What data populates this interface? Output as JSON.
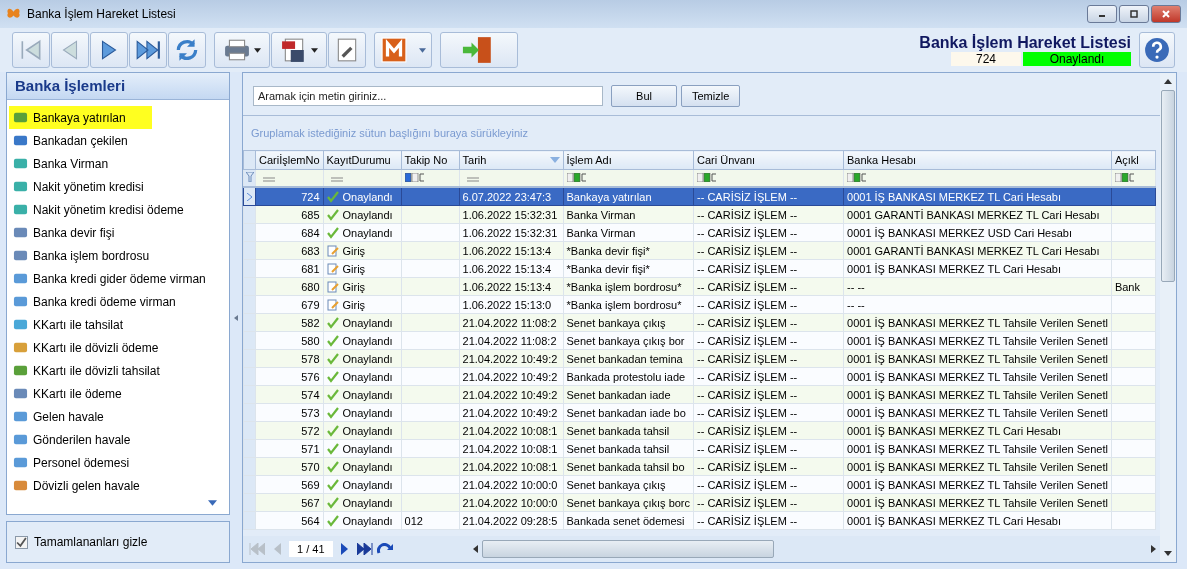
{
  "window": {
    "title": "Banka İşlem Hareket Listesi"
  },
  "header": {
    "title": "Banka İşlem Hareket Listesi",
    "record_no": "724",
    "status": "Onaylandı"
  },
  "sidebar": {
    "title": "Banka İşlemleri",
    "items": [
      {
        "label": "Bankaya yatırılan",
        "selected": true
      },
      {
        "label": "Bankadan çekilen",
        "selected": false
      },
      {
        "label": "Banka Virman",
        "selected": false
      },
      {
        "label": "Nakit yönetim kredisi",
        "selected": false
      },
      {
        "label": "Nakit yönetim kredisi ödeme",
        "selected": false
      },
      {
        "label": "Banka devir fişi",
        "selected": false
      },
      {
        "label": "Banka işlem bordrosu",
        "selected": false
      },
      {
        "label": "Banka kredi gider ödeme virman",
        "selected": false
      },
      {
        "label": "Banka kredi ödeme virman",
        "selected": false
      },
      {
        "label": "KKartı ile tahsilat",
        "selected": false
      },
      {
        "label": "KKartı ile dövizli ödeme",
        "selected": false
      },
      {
        "label": "KKartı ile dövizli tahsilat",
        "selected": false
      },
      {
        "label": "KKartı ile ödeme",
        "selected": false
      },
      {
        "label": "Gelen havale",
        "selected": false
      },
      {
        "label": "Gönderilen havale",
        "selected": false
      },
      {
        "label": "Personel ödemesi",
        "selected": false
      },
      {
        "label": "Dövizli gelen havale",
        "selected": false
      }
    ],
    "hide_completed": {
      "label": "Tamamlananları gizle",
      "checked": true
    }
  },
  "search": {
    "placeholder": "Aramak için metin giriniz...",
    "find_button": "Bul",
    "clear_button": "Temizle"
  },
  "group_hint": "Gruplamak istediğiniz sütun başlığını buraya sürükleyiniz",
  "table": {
    "columns": [
      {
        "label": "CariİşlemNo",
        "sorted": false,
        "kind": "equals"
      },
      {
        "label": "KayıtDurumu",
        "sorted": false,
        "kind": "equals"
      },
      {
        "label": "Takip No",
        "sorted": false,
        "kind": "text"
      },
      {
        "label": "Tarih",
        "sorted": true,
        "kind": "equals"
      },
      {
        "label": "İşlem Adı",
        "sorted": false,
        "kind": "text"
      },
      {
        "label": "Cari Ünvanı",
        "sorted": false,
        "kind": "text"
      },
      {
        "label": "Banka Hesabı",
        "sorted": false,
        "kind": "text"
      },
      {
        "label": "Açıkl",
        "sorted": false,
        "kind": "text"
      }
    ],
    "rows": [
      {
        "selected": true,
        "no": "724",
        "status": {
          "kind": "approved",
          "label": "Onaylandı"
        },
        "takip": "",
        "date": "6.07.2022 23:47:3",
        "name": "Bankaya yatırılan",
        "cari": "-- CARİSİZ İŞLEM --",
        "bank": "0001 İŞ BANKASI MERKEZ TL Cari Hesabı",
        "note": ""
      },
      {
        "selected": false,
        "no": "685",
        "status": {
          "kind": "approved",
          "label": "Onaylandı"
        },
        "takip": "",
        "date": "1.06.2022 15:32:31",
        "name": "Banka Virman",
        "cari": "-- CARİSİZ İŞLEM --",
        "bank": "0001 GARANTİ BANKASI MERKEZ TL Cari Hesabı",
        "note": ""
      },
      {
        "selected": false,
        "no": "684",
        "status": {
          "kind": "approved",
          "label": "Onaylandı"
        },
        "takip": "",
        "date": "1.06.2022 15:32:31",
        "name": "Banka Virman",
        "cari": "-- CARİSİZ İŞLEM --",
        "bank": "0001 İŞ BANKASI MERKEZ USD Cari Hesabı",
        "note": ""
      },
      {
        "selected": false,
        "no": "683",
        "status": {
          "kind": "entry",
          "label": "Giriş"
        },
        "takip": "",
        "date": "1.06.2022 15:13:4",
        "name": "*Banka devir fişi*",
        "cari": "-- CARİSİZ İŞLEM --",
        "bank": "0001 GARANTİ BANKASI MERKEZ TL Cari Hesabı",
        "note": ""
      },
      {
        "selected": false,
        "no": "681",
        "status": {
          "kind": "entry",
          "label": "Giriş"
        },
        "takip": "",
        "date": "1.06.2022 15:13:4",
        "name": "*Banka devir fişi*",
        "cari": "-- CARİSİZ İŞLEM --",
        "bank": "0001 İŞ BANKASI MERKEZ TL Cari Hesabı",
        "note": ""
      },
      {
        "selected": false,
        "no": "680",
        "status": {
          "kind": "entry",
          "label": "Giriş"
        },
        "takip": "",
        "date": "1.06.2022 15:13:4",
        "name": "*Banka işlem bordrosu*",
        "cari": "-- CARİSİZ İŞLEM --",
        "bank": "-- --",
        "note": "Bank"
      },
      {
        "selected": false,
        "no": "679",
        "status": {
          "kind": "entry",
          "label": "Giriş"
        },
        "takip": "",
        "date": "1.06.2022 15:13:0",
        "name": "*Banka işlem bordrosu*",
        "cari": "-- CARİSİZ İŞLEM --",
        "bank": "-- --",
        "note": ""
      },
      {
        "selected": false,
        "no": "582",
        "status": {
          "kind": "approved",
          "label": "Onaylandı"
        },
        "takip": "",
        "date": "21.04.2022 11:08:2",
        "name": "Senet bankaya çıkış",
        "cari": "-- CARİSİZ İŞLEM --",
        "bank": "0001 İŞ BANKASI MERKEZ TL Tahsile Verilen Senetl",
        "note": ""
      },
      {
        "selected": false,
        "no": "580",
        "status": {
          "kind": "approved",
          "label": "Onaylandı"
        },
        "takip": "",
        "date": "21.04.2022 11:08:2",
        "name": "Senet bankaya çıkış bor",
        "cari": "-- CARİSİZ İŞLEM --",
        "bank": "0001 İŞ BANKASI MERKEZ TL Tahsile Verilen Senetl",
        "note": ""
      },
      {
        "selected": false,
        "no": "578",
        "status": {
          "kind": "approved",
          "label": "Onaylandı"
        },
        "takip": "",
        "date": "21.04.2022 10:49:2",
        "name": "Senet bankadan temina",
        "cari": "-- CARİSİZ İŞLEM --",
        "bank": "0001 İŞ BANKASI MERKEZ TL Tahsile Verilen Senetl",
        "note": ""
      },
      {
        "selected": false,
        "no": "576",
        "status": {
          "kind": "approved",
          "label": "Onaylandı"
        },
        "takip": "",
        "date": "21.04.2022 10:49:2",
        "name": "Bankada protestolu iade",
        "cari": "-- CARİSİZ İŞLEM --",
        "bank": "0001 İŞ BANKASI MERKEZ TL Tahsile Verilen Senetl",
        "note": ""
      },
      {
        "selected": false,
        "no": "574",
        "status": {
          "kind": "approved",
          "label": "Onaylandı"
        },
        "takip": "",
        "date": "21.04.2022 10:49:2",
        "name": "Senet bankadan iade",
        "cari": "-- CARİSİZ İŞLEM --",
        "bank": "0001 İŞ BANKASI MERKEZ TL Tahsile Verilen Senetl",
        "note": ""
      },
      {
        "selected": false,
        "no": "573",
        "status": {
          "kind": "approved",
          "label": "Onaylandı"
        },
        "takip": "",
        "date": "21.04.2022 10:49:2",
        "name": "Senet bankadan iade bo",
        "cari": "-- CARİSİZ İŞLEM --",
        "bank": "0001 İŞ BANKASI MERKEZ TL Tahsile Verilen Senetl",
        "note": ""
      },
      {
        "selected": false,
        "no": "572",
        "status": {
          "kind": "approved",
          "label": "Onaylandı"
        },
        "takip": "",
        "date": "21.04.2022 10:08:1",
        "name": "Senet bankada tahsil",
        "cari": "-- CARİSİZ İŞLEM --",
        "bank": "0001 İŞ BANKASI MERKEZ TL Cari Hesabı",
        "note": ""
      },
      {
        "selected": false,
        "no": "571",
        "status": {
          "kind": "approved",
          "label": "Onaylandı"
        },
        "takip": "",
        "date": "21.04.2022 10:08:1",
        "name": "Senet bankada tahsil",
        "cari": "-- CARİSİZ İŞLEM --",
        "bank": "0001 İŞ BANKASI MERKEZ TL Tahsile Verilen Senetl",
        "note": ""
      },
      {
        "selected": false,
        "no": "570",
        "status": {
          "kind": "approved",
          "label": "Onaylandı"
        },
        "takip": "",
        "date": "21.04.2022 10:08:1",
        "name": "Senet bankada tahsil bo",
        "cari": "-- CARİSİZ İŞLEM --",
        "bank": "0001 İŞ BANKASI MERKEZ TL Tahsile Verilen Senetl",
        "note": ""
      },
      {
        "selected": false,
        "no": "569",
        "status": {
          "kind": "approved",
          "label": "Onaylandı"
        },
        "takip": "",
        "date": "21.04.2022 10:00:0",
        "name": "Senet bankaya çıkış",
        "cari": "-- CARİSİZ İŞLEM --",
        "bank": "0001 İŞ BANKASI MERKEZ TL Tahsile Verilen Senetl",
        "note": ""
      },
      {
        "selected": false,
        "no": "567",
        "status": {
          "kind": "approved",
          "label": "Onaylandı"
        },
        "takip": "",
        "date": "21.04.2022 10:00:0",
        "name": "Senet bankaya çıkış borc",
        "cari": "-- CARİSİZ İŞLEM --",
        "bank": "0001 İŞ BANKASI MERKEZ TL Tahsile Verilen Senetl",
        "note": ""
      },
      {
        "selected": false,
        "no": "564",
        "status": {
          "kind": "approved",
          "label": "Onaylandı"
        },
        "takip": "012",
        "date": "21.04.2022 09:28:5",
        "name": "Bankada senet ödemesi",
        "cari": "-- CARİSİZ İŞLEM --",
        "bank": "0001 İŞ BANKASI MERKEZ TL Cari Hesabı",
        "note": ""
      }
    ]
  },
  "pager": {
    "page": "1 / 41"
  }
}
